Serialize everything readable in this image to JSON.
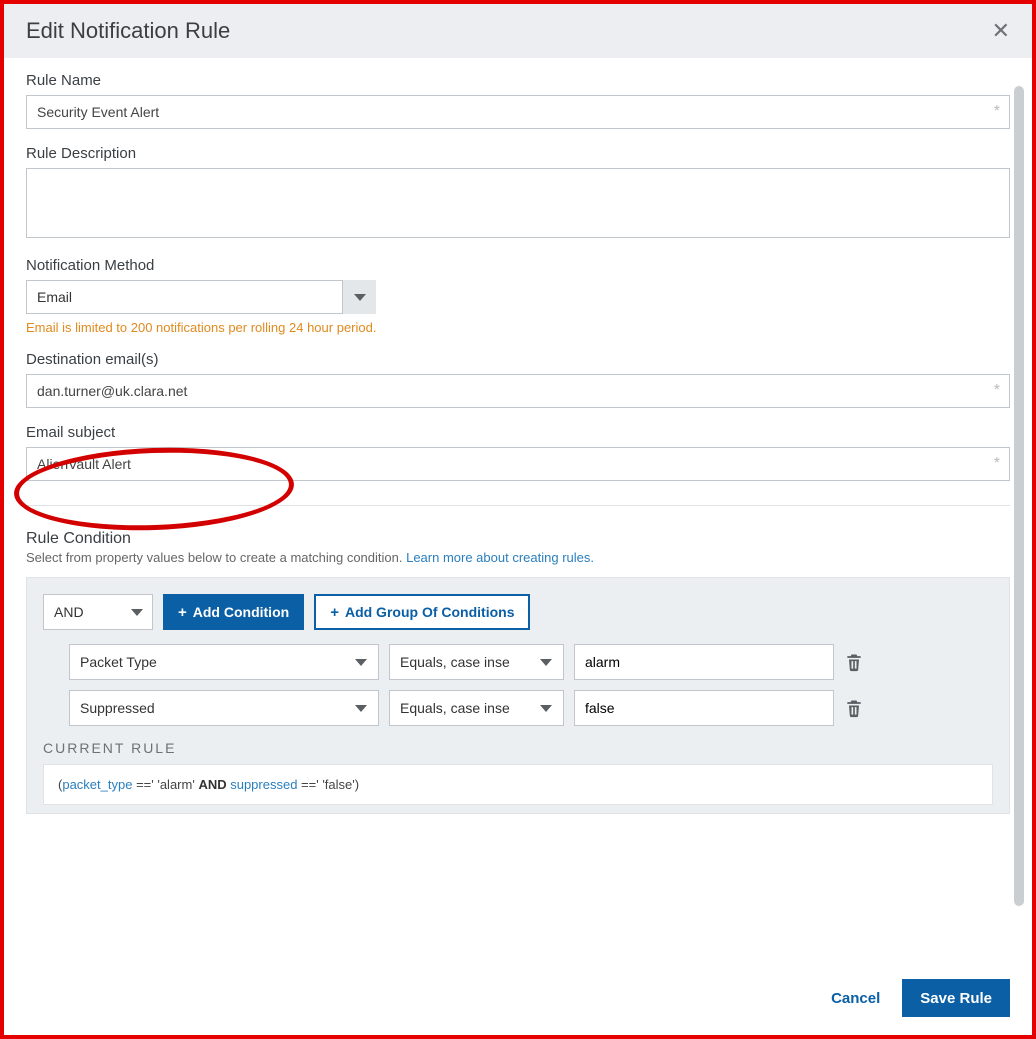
{
  "header": {
    "title": "Edit Notification Rule"
  },
  "fields": {
    "rule_name": {
      "label": "Rule Name",
      "value": "Security Event Alert"
    },
    "rule_description": {
      "label": "Rule Description",
      "value": ""
    },
    "notification_method": {
      "label": "Notification Method",
      "value": "Email",
      "warning": "Email is limited to 200 notifications per rolling 24 hour period."
    },
    "destination_emails": {
      "label": "Destination email(s)",
      "value": "dan.turner@uk.clara.net"
    },
    "email_subject": {
      "label": "Email subject",
      "value": "AlienVault Alert"
    }
  },
  "rule_condition": {
    "heading": "Rule Condition",
    "subtext": "Select from property values below to create a matching condition. ",
    "learn_more": "Learn more about creating rules.",
    "logic": "AND",
    "buttons": {
      "add_condition": "Add Condition",
      "add_group": "Add Group Of Conditions"
    },
    "rows": [
      {
        "property": "Packet Type",
        "operator": "Equals, case inse",
        "value": "alarm"
      },
      {
        "property": "Suppressed",
        "operator": "Equals, case inse",
        "value": "false"
      }
    ],
    "current_rule": {
      "heading": "CURRENT RULE",
      "expr": {
        "open": "(",
        "k1": "packet_type",
        "eq1": " ==' 'alarm' ",
        "and": "AND",
        "k2": " suppressed",
        "eq2": " ==' 'false')"
      }
    }
  },
  "footer": {
    "cancel": "Cancel",
    "save": "Save Rule"
  }
}
